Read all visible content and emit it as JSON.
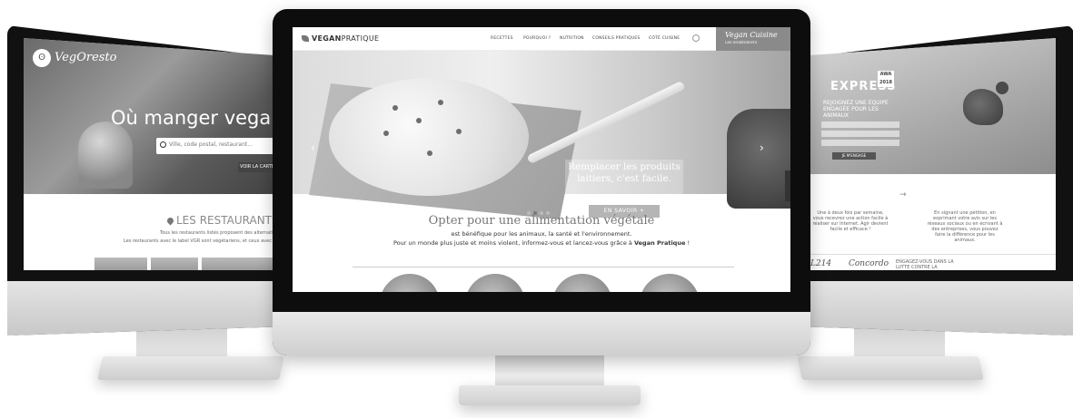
{
  "left": {
    "logo": "VegOresto",
    "hero_title": "Où manger vegan au res",
    "search_placeholder": "Ville, code postal, restaurant...",
    "map_button": "VOIR LA CARTE",
    "section_title": "LES RESTAURANTS AUTOU",
    "text_line1": "Tous les restaurants listés proposent des alternatives",
    "text_line2": "Les restaurants avec le label VGR sont végétariens, et ceux avec le label"
  },
  "center": {
    "logo_bold": "VEGAN",
    "logo_rest": "PRATIQUE",
    "menu": [
      "RECETTES",
      "POURQUOI ?",
      "NUTRITION",
      "CONSEILS PRATIQUES",
      "CÔTÉ CUISINE"
    ],
    "cuisine_title": "Vegan Cuisine",
    "cuisine_sub": "LES INGRÉDIENTS",
    "hero_caption_line1": "Remplacer les produits",
    "hero_caption_line2": "laitiers, c'est facile.",
    "hero_button": "EN SAVOIR +",
    "heading": "Opter pour une alimentation végétale",
    "para_line1": "est bénéfique pour les animaux, la santé et l'environnement.",
    "para_line2_a": "Pour un monde plus juste et moins violent, informez-vous et lancez-vous grâce à ",
    "para_line2_b": "Vegan Pratique",
    "para_line2_c": " !"
  },
  "right": {
    "title": "EXPRESS",
    "badge": "AWA 2018",
    "subtitle": "REJOIGNEZ UNE ÉQUIPE ENGAGÉE POUR LES ANIMAUX",
    "sign_button": "JE M'ENGAGE",
    "col1_text": "Une à deux fois par semaine, vous recevrez une action facile à réaliser sur Internet. Agir devient facile et efficace !",
    "col2_text": "En signant une pétition, en exprimant votre avis sur les réseaux sociaux ou en écrivant à des entreprises, vous pouvez faire la différence pour les animaux.",
    "partner_left": "L214",
    "partner_logo": "Concordo",
    "partner_text": "ENGAGEZ-VOUS DANS LA LUTTE CONTRE LA SOUFFRANCE ANIMALE"
  }
}
